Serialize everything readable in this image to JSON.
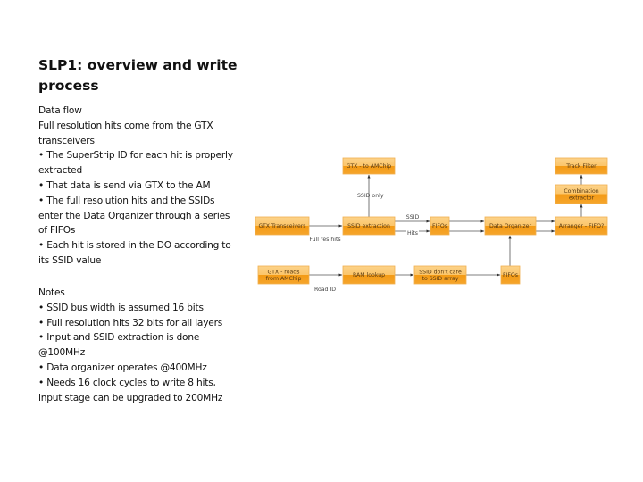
{
  "slide": {
    "title": "SLP1: overview and write process",
    "data_flow": {
      "heading": "Data flow",
      "intro": "Full resolution hits come from the GTX transceivers",
      "bullets": [
        "• The SuperStrip ID for each hit is properly extracted",
        "• That data is send via GTX to the AM",
        "• The full resolution hits and the SSIDs enter the Data Organizer through a series of FIFOs",
        "• Each hit is stored in the DO according to its SSID value"
      ]
    },
    "notes": {
      "heading": "Notes",
      "bullets": [
        "• SSID bus width is assumed 16 bits",
        "• Full resolution hits 32 bits for all layers",
        "• Input and SSID extraction is done @100MHz",
        "• Data organizer operates @400MHz",
        "• Needs 16 clock cycles to write 8 hits, input stage can be upgraded to 200MHz"
      ]
    }
  },
  "diagram": {
    "colors": {
      "box_top": "#fbc56a",
      "box_bottom": "#f49a14",
      "box_border": "#f0b050",
      "edge": "#555555"
    },
    "nodes": {
      "gtx_amchip": [
        "GTX - to AMChip"
      ],
      "track_filter": [
        "Track Filter"
      ],
      "combination_extractor": [
        "Combination",
        "extractor"
      ],
      "gtx_transceivers": [
        "GTX Transceivers"
      ],
      "ssid_extraction": [
        "SSID extraction"
      ],
      "fifos_top": [
        "FIFOs"
      ],
      "data_organizer": [
        "Data Organizer"
      ],
      "arranger": [
        "Arranger - FIFO?"
      ],
      "gtx_roads": [
        "GTX - roads",
        "from AMChip"
      ],
      "ram_lookup": [
        "RAM lookup"
      ],
      "ssid_dont_care": [
        "SSID don't care",
        "to SSID array"
      ],
      "fifos_bottom": [
        "FIFOs"
      ]
    },
    "edge_labels": {
      "ssid_only": "SSID only",
      "ssid": "SSID",
      "hits": "Hits",
      "full_res_hits": "Full res hits",
      "road_id": "Road ID"
    }
  }
}
